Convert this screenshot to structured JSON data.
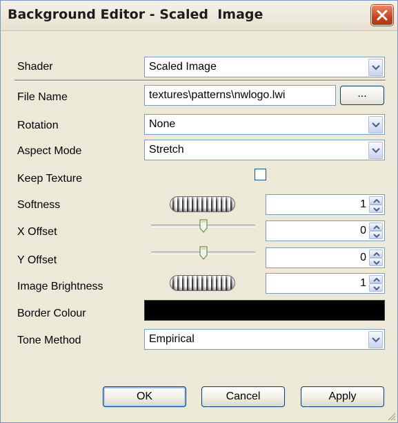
{
  "window": {
    "title": "Background Editor - Scaled  Image"
  },
  "labels": {
    "shader": "Shader",
    "file_name": "File Name",
    "rotation": "Rotation",
    "aspect_mode": "Aspect Mode",
    "keep_texture": "Keep Texture",
    "softness": "Softness",
    "x_offset": "X Offset",
    "y_offset": "Y Offset",
    "image_brightness": "Image Brightness",
    "border_colour": "Border Colour",
    "tone_method": "Tone Method"
  },
  "values": {
    "shader": "Scaled Image",
    "file_name": "textures\\patterns\\nwlogo.lwi",
    "rotation": "None",
    "aspect_mode": "Stretch",
    "keep_texture": false,
    "softness": "1",
    "x_offset": "0",
    "y_offset": "0",
    "image_brightness": "1",
    "border_colour": "#000000",
    "tone_method": "Empirical"
  },
  "sliders": {
    "x_offset_fraction": 0.5,
    "y_offset_fraction": 0.5
  },
  "buttons": {
    "browse": "...",
    "ok": "OK",
    "cancel": "Cancel",
    "apply": "Apply"
  },
  "colors": {
    "dialog_bg": "#ece9d8",
    "close_button": "#c8431f",
    "field_border": "#7f9db9",
    "button_border": "#003c74"
  },
  "icons": {
    "close": "close-icon",
    "dropdown": "chevron-down-icon",
    "spin_up": "arrow-up-icon",
    "spin_down": "arrow-down-icon",
    "resize": "resize-grip-icon"
  }
}
